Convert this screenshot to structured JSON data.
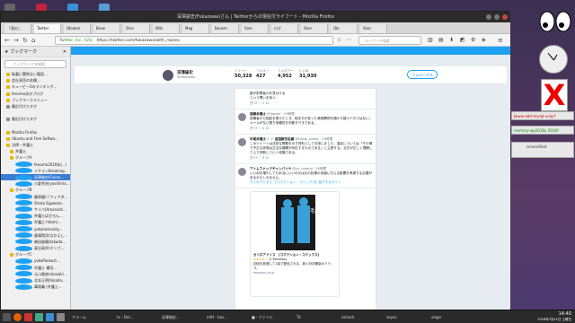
{
  "window": {
    "title": "深澤諭史(Fukazawa)さん | Twitterからの現在付ライフート - Mozilla Firefox"
  },
  "tabs": [
    {
      "label": "「君の」"
    },
    {
      "label": "Twitter"
    },
    {
      "label": "(Bookm"
    },
    {
      "label": "Brow"
    },
    {
      "label": "Shor"
    },
    {
      "label": "Wiki"
    },
    {
      "label": "Mag"
    },
    {
      "label": "Bookm"
    },
    {
      "label": "Sam"
    },
    {
      "label": "ログ"
    },
    {
      "label": "Shor"
    },
    {
      "label": "(Bo"
    },
    {
      "label": "Shor"
    }
  ],
  "nav": {
    "url": "https://twitter.com/fukazawa/with_replies",
    "site_label": "Twitter, Inc. (US)",
    "search_placeholder": "キーワード検索"
  },
  "sidebar": {
    "title": "ブックマーク",
    "search_placeholder": "ブックマークを検索",
    "items": [
      {
        "label": "転載に関係ない電話...",
        "type": "folder"
      },
      {
        "label": "会社発売の本棚...",
        "type": "folder"
      },
      {
        "label": "キューピー2のランキング...",
        "type": "folder"
      },
      {
        "label": "fenomo次のブログ",
        "type": "folder"
      },
      {
        "label": "ブックマークメニュー",
        "type": "folder"
      },
      {
        "label": "最近付けたタグ",
        "type": "tag"
      },
      {
        "label": "",
        "type": "spacer"
      },
      {
        "label": "最近付けたタグ",
        "type": "tag"
      },
      {
        "label": "",
        "type": "spacer"
      },
      {
        "label": "Mozilla Firefox",
        "type": "folder"
      },
      {
        "label": "Ubuntu and Free Softwa...",
        "type": "folder"
      },
      {
        "label": "法律・弁護士",
        "type": "folder"
      },
      {
        "label": "弁護士",
        "type": "folder"
      },
      {
        "label": "グループA",
        "type": "folder"
      },
      {
        "label": "fenomo2016年(...)",
        "type": "twitter"
      },
      {
        "label": "ミケランBreaking...",
        "type": "twitter"
      },
      {
        "label": "深澤諭史(Fukaz...",
        "type": "twitter",
        "selected": true
      },
      {
        "label": "小倉秀夫(yoshihiro...",
        "type": "twitter"
      },
      {
        "label": "グループB",
        "type": "folder"
      },
      {
        "label": "藤原健(ゾフィアダ...",
        "type": "twitter"
      },
      {
        "label": "Shoko Egawa(e...",
        "type": "twitter"
      },
      {
        "label": "サイバ(Amanarit...",
        "type": "twitter"
      },
      {
        "label": "弁護士ばびろん...",
        "type": "twitter"
      },
      {
        "label": "弁護士 hitomi...",
        "type": "twitter"
      },
      {
        "label": "yokohamacity...",
        "type": "twitter"
      },
      {
        "label": "唐澤貴洋(なかよし...",
        "type": "twitter"
      },
      {
        "label": "暁田崩壊(takada...",
        "type": "twitter"
      },
      {
        "label": "真谷高弁(オンブ...",
        "type": "twitter"
      },
      {
        "label": "グループC",
        "type": "folder"
      },
      {
        "label": "yokoPoekoの...",
        "type": "twitter"
      },
      {
        "label": "弁護士 横田...",
        "type": "twitter"
      },
      {
        "label": "元川政彦(okazaki...",
        "type": "twitter"
      },
      {
        "label": "北本正明(hikada...",
        "type": "twitter"
      },
      {
        "label": "萬壇義 (弁護士...",
        "type": "twitter"
      }
    ]
  },
  "profile": {
    "name": "深澤諭史",
    "handle": "@fukazawa",
    "stats": [
      {
        "label": "ツイート",
        "value": "50,328"
      },
      {
        "label": "フォロー",
        "value": "427"
      },
      {
        "label": "フォロワー",
        "value": "4,952"
      },
      {
        "label": "いいね",
        "value": "31,930"
      }
    ],
    "follow_label": "フォローする"
  },
  "tweets": [
    {
      "name": "",
      "meta": "",
      "text": "誰が犯罪者かを見分ける",
      "extra": "という問いを持つ",
      "counts": "1  12"
    },
    {
      "name": "遠藤弁護士",
      "meta": "@lawyer · 29時間",
      "text": "依頼者から相談を受けたとき、相手方が言った事実関係を頭から疑うべきではない。ルールがない限り信頼性を判断すべきである。",
      "extra": "",
      "counts": "4  11"
    },
    {
      "name": "中尾弁護士 ✓ ✓ 自国新旧名義",
      "meta": "@takao_hawar · 20時間",
      "text": "このツイートは法的な問題を示す資料として引用しました。違反については「その場で不正な状態は正当な機関が対応するものである」と主張する。当方が正しく理解して上で判断していく段階である。",
      "extra": "",
      "counts": "5  11"
    },
    {
      "name": "アトムファックチャンパイナ",
      "meta": "@ux_madnd · 20時間",
      "text": "いいねを増やしても本当にいいのかは元の記事の言論に与える影響を考慮する必要があるかもしれません。",
      "extra": "モリのアドセス 【コマクション・コミックス】紹介するサイト",
      "counts": ""
    }
  ],
  "book_card": {
    "title": "セリロアドリス　[コマクション・コミックス]",
    "stars": "★★★★☆",
    "reviews": "(1 Reviews)",
    "desc": "初回を新連して1話で配信される、新人対初期版のドラマ。",
    "source": "amazon.co.jp"
  },
  "right_panel": {
    "notes": [
      "Jwww-add-mysql-unig-f",
      "memory wp2018y 2018Y",
      "screenShot"
    ]
  },
  "taskbar": {
    "items": [
      "アラーム",
      "tv - Dol...",
      "深澤諭史...",
      "e4tt - bas...",
      "■ - ファイル",
      "Tk",
      "ssclock",
      "xeyes",
      "xlogo"
    ],
    "time": "14:40",
    "date": "2018年7月21日 土曜日"
  },
  "colors": {
    "twitter_blue": "#1da1f2",
    "sidebar_selected": "#3a7bd5",
    "desktop": "#3d3450"
  }
}
